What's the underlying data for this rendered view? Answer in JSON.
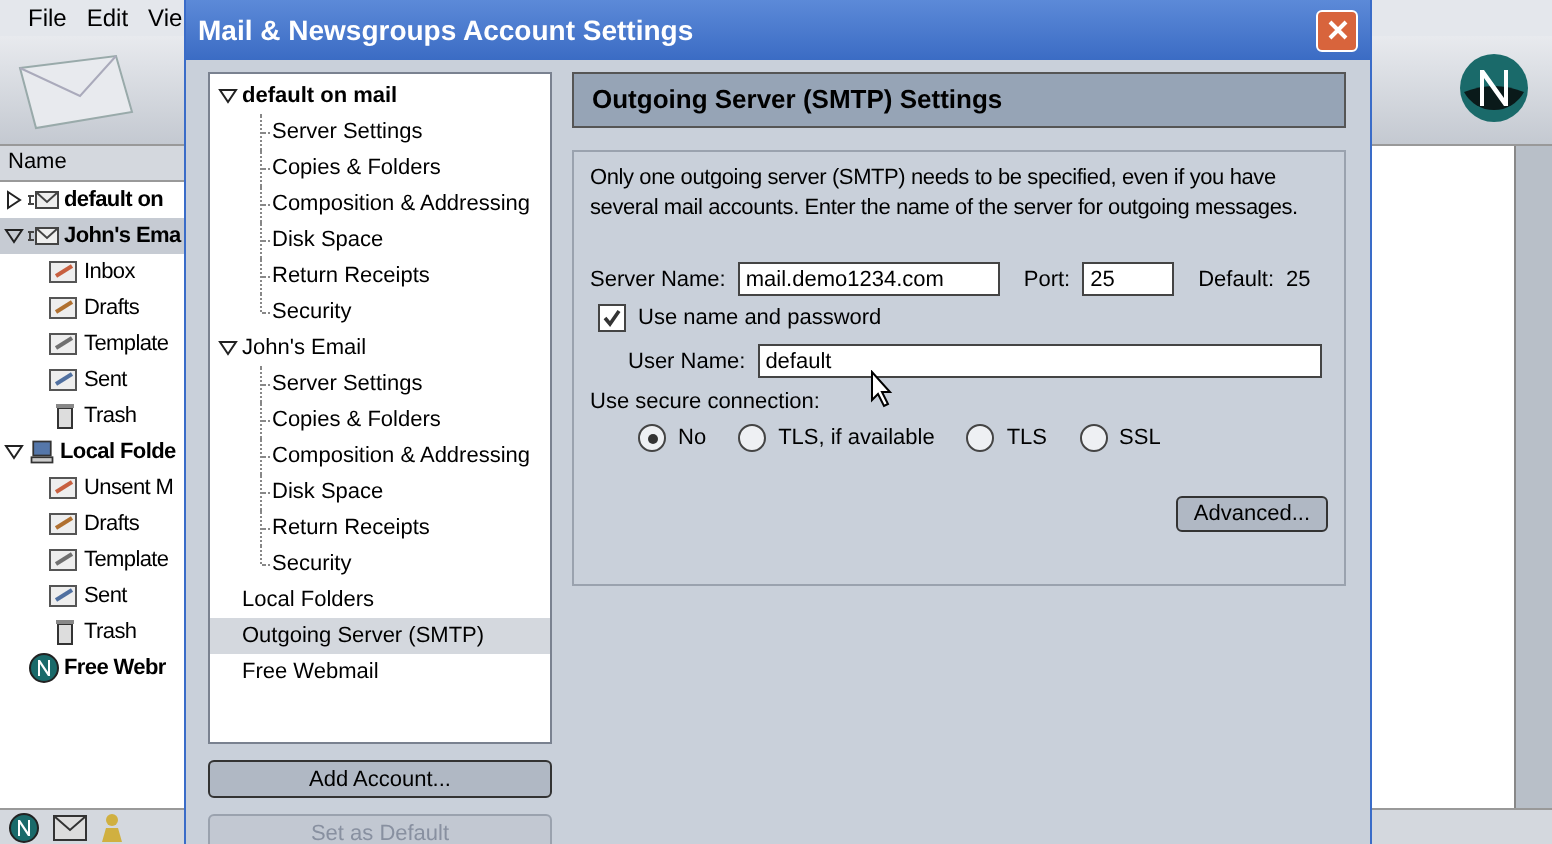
{
  "app": {
    "menu": [
      "File",
      "Edit",
      "Vie"
    ],
    "column_header": "Name",
    "folders": [
      {
        "label": "default on",
        "kind": "account",
        "expanded": false,
        "selected": false
      },
      {
        "label": "John's Ema",
        "kind": "account",
        "expanded": true,
        "selected": true,
        "children": [
          {
            "label": "Inbox",
            "kind": "inbox",
            "selected": false
          },
          {
            "label": "Drafts",
            "kind": "drafts",
            "selected": false
          },
          {
            "label": "Template",
            "kind": "templates",
            "selected": false
          },
          {
            "label": "Sent",
            "kind": "sent",
            "selected": false
          },
          {
            "label": "Trash",
            "kind": "trash",
            "selected": false
          }
        ]
      },
      {
        "label": "Local Folde",
        "kind": "local",
        "expanded": true,
        "selected": false,
        "children": [
          {
            "label": "Unsent M",
            "kind": "unsent",
            "selected": false
          },
          {
            "label": "Drafts",
            "kind": "drafts",
            "selected": false
          },
          {
            "label": "Template",
            "kind": "templates",
            "selected": false
          },
          {
            "label": "Sent",
            "kind": "sent",
            "selected": false
          },
          {
            "label": "Trash",
            "kind": "trash",
            "selected": false
          }
        ]
      },
      {
        "label": "Free Webr",
        "kind": "webmail",
        "selected": false
      }
    ]
  },
  "dialog": {
    "title": "Mail & Newsgroups Account Settings",
    "tree": [
      {
        "label": "default on mail",
        "bold": true,
        "expanded": true,
        "selected": false,
        "children": [
          {
            "label": "Server Settings",
            "selected": false
          },
          {
            "label": "Copies & Folders",
            "selected": false
          },
          {
            "label": "Composition & Addressing",
            "selected": false
          },
          {
            "label": "Disk Space",
            "selected": false
          },
          {
            "label": "Return Receipts",
            "selected": false
          },
          {
            "label": "Security",
            "selected": false
          }
        ]
      },
      {
        "label": "John's Email",
        "bold": false,
        "expanded": true,
        "selected": false,
        "children": [
          {
            "label": "Server Settings",
            "selected": false
          },
          {
            "label": "Copies & Folders",
            "selected": false
          },
          {
            "label": "Composition & Addressing",
            "selected": false
          },
          {
            "label": "Disk Space",
            "selected": false
          },
          {
            "label": "Return Receipts",
            "selected": false
          },
          {
            "label": "Security",
            "selected": false
          }
        ]
      },
      {
        "label": "Local Folders",
        "bold": false,
        "selected": false
      },
      {
        "label": "Outgoing Server (SMTP)",
        "bold": false,
        "selected": true
      },
      {
        "label": "Free Webmail",
        "bold": false,
        "selected": false
      }
    ],
    "buttons": [
      {
        "label": "Add Account...",
        "disabled": false
      },
      {
        "label": "Set as Default",
        "disabled": true
      }
    ],
    "panel": {
      "heading": "Outgoing Server (SMTP) Settings",
      "description": "Only one outgoing server (SMTP) needs to be specified, even if you have several mail accounts. Enter the name of the server for outgoing messages.",
      "server_name": {
        "label": "Server Name:",
        "value": "mail.demo1234.com"
      },
      "port": {
        "label": "Port:",
        "value": "25"
      },
      "default": {
        "label": "Default:",
        "value": "25"
      },
      "use_password": {
        "label": "Use name and password",
        "checked": true
      },
      "user_name": {
        "label": "User Name:",
        "value": "default"
      },
      "secure_label": "Use secure connection:",
      "secure_options": [
        {
          "label": "No",
          "selected": true
        },
        {
          "label": "TLS, if available",
          "selected": false
        },
        {
          "label": "TLS",
          "selected": false
        },
        {
          "label": "SSL",
          "selected": false
        }
      ],
      "advanced_button": "Advanced..."
    }
  }
}
